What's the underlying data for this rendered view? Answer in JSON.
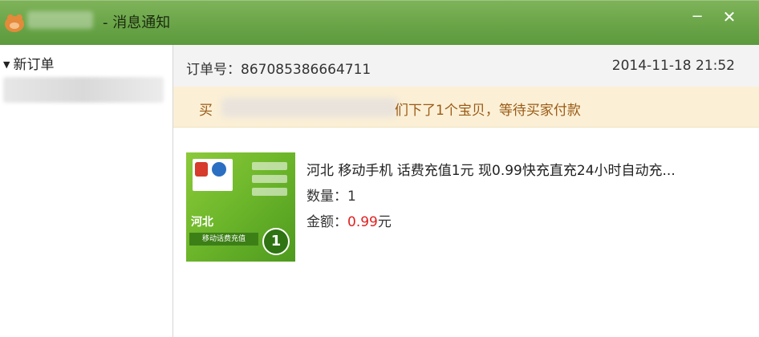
{
  "window": {
    "title": "- 消息通知",
    "minimize_icon": "minimize-icon",
    "close_icon": "close-icon"
  },
  "sidebar": {
    "group_label": "新订单"
  },
  "order": {
    "number_label": "订单号：",
    "number": "867085386664711",
    "time": "2014-11-18 21:52"
  },
  "notice": {
    "prefix": "买",
    "text": "们下了1个宝贝，等待买家付款"
  },
  "product": {
    "title": "河北 移动手机 话费充值1元 现0.99快充直充24小时自动充...",
    "quantity_label": "数量：",
    "quantity": "1",
    "amount_label": "金额：",
    "price": "0.99",
    "price_unit": "元",
    "thumb": {
      "province": "河北",
      "strip": "移动话费充值",
      "denomination": "1"
    }
  },
  "colors": {
    "titlebar": "#6aa548",
    "notice_bg": "#fbf0d6",
    "notice_text": "#9a5a16",
    "price": "#e02020"
  }
}
